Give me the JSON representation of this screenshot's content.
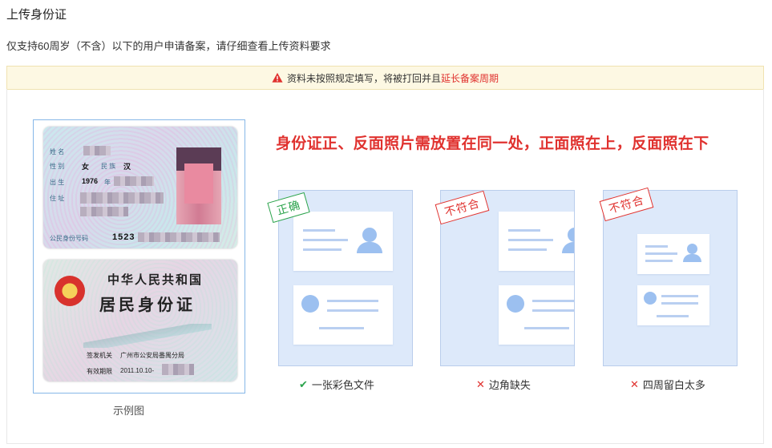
{
  "header": {
    "title": "上传身份证",
    "subtitle": "仅支持60周岁（不含）以下的用户申请备案，请仔细查看上传资料要求"
  },
  "warning": {
    "icon": "warning-triangle-icon",
    "text": "资料未按照规定填写，将被打回并且",
    "highlight": "延长备案周期",
    "color": "#e0322f"
  },
  "example": {
    "label": "示例图",
    "front": {
      "name_label": "姓 名",
      "gender_label": "性 别",
      "gender_value": "女",
      "ethnicity_label": "民 族",
      "ethnicity_value": "汉",
      "birth_label": "出 生",
      "birth_year": "1976",
      "birth_year_suffix": "年",
      "address_label": "住 址",
      "id_label": "公民身份号码",
      "id_prefix": "1523"
    },
    "back": {
      "title1": "中华人民共和国",
      "title2": "居民身份证",
      "issuer_label": "签发机关",
      "issuer_value": "广州市公安局番禺分局",
      "validity_label": "有效期限",
      "validity_value": "2011.10.10-"
    }
  },
  "requirements": {
    "headline": "身份证正、反面照片需放置在同一处，正面照在上，反面照在下",
    "samples": [
      {
        "stamp": "正确",
        "status": "ok",
        "caption": "一张彩色文件",
        "mark_icon": "check-icon",
        "mark": "✔"
      },
      {
        "stamp": "不符合",
        "status": "bad",
        "caption": "边角缺失",
        "mark_icon": "cross-icon",
        "mark": "✕"
      },
      {
        "stamp": "不符合",
        "status": "bad",
        "caption": "四周留白太多",
        "mark_icon": "cross-icon",
        "mark": "✕"
      }
    ]
  },
  "colors": {
    "accent_red": "#e0322f",
    "ok_green": "#2ba34c",
    "sample_bg": "#dde9fa",
    "warn_bg": "#fdf8e3"
  }
}
